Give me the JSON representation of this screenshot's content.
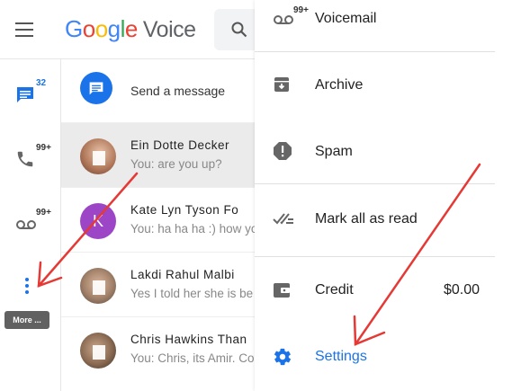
{
  "header": {
    "logo_letters": [
      "G",
      "o",
      "o",
      "g",
      "l",
      "e"
    ],
    "logo_product": "Voice",
    "icons": [
      "menu-icon",
      "search-icon"
    ]
  },
  "rail": {
    "messages_badge": "32",
    "calls_badge": "99+",
    "voicemail_badge": "99+",
    "more_tooltip": "More ..."
  },
  "list": {
    "send_message": "Send a message",
    "conversations": [
      {
        "name": "Ein Dotte Decker",
        "snippet": "You: are you up?",
        "avatar": "photo",
        "selected": true
      },
      {
        "name": "Kate Lyn Tyson Fo",
        "snippet": "You: ha ha ha :) how yo",
        "avatar": "K",
        "selected": false
      },
      {
        "name": "Lakdi Rahul Malbi",
        "snippet": "Yes I told her she is be",
        "avatar": "photo",
        "selected": false
      },
      {
        "name": "Chris Hawkins Than",
        "snippet": "You: Chris, its Amir. Co",
        "avatar": "photo",
        "selected": false
      }
    ]
  },
  "menu": {
    "voicemail_badge": "99+",
    "voicemail": "Voicemail",
    "archive": "Archive",
    "spam": "Spam",
    "mark_all_read": "Mark all as read",
    "credit": "Credit",
    "credit_value": "$0.00",
    "settings": "Settings"
  },
  "colors": {
    "accent": "#1a73e8",
    "annotation_arrow": "#e53935"
  }
}
